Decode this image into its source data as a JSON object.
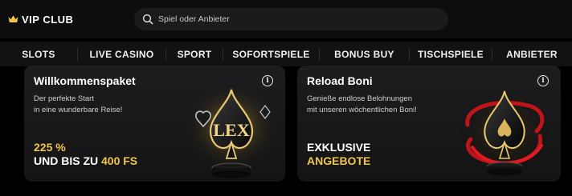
{
  "header": {
    "logo_text": "VIP CLUB",
    "logo_icon": "crown-icon",
    "search_placeholder": "Spiel oder Anbieter",
    "search_icon": "search-icon"
  },
  "nav": {
    "items": [
      {
        "label": "SLOTS"
      },
      {
        "label": "LIVE CASINO"
      },
      {
        "label": "SPORT"
      },
      {
        "label": "SOFORTSPIELE"
      },
      {
        "label": "BONUS BUY"
      },
      {
        "label": "TISCHSPIELE"
      },
      {
        "label": "ANBIETER"
      }
    ]
  },
  "cards": [
    {
      "title": "Willkommenspaket",
      "desc_line1": "Der perfekte Start",
      "desc_line2": "in eine wunderbare Reise!",
      "promo_line1_value": "225 %",
      "promo_line2_prefix": "UND BIS ZU ",
      "promo_line2_value": "400 FS",
      "art_text": "LEX"
    },
    {
      "title": "Reload Boni",
      "desc_line1": "Genieße endlose Belohnungen",
      "desc_line2": "mit unseren wöchentlichen Boni!",
      "promo_line1": "EXKLUSIVE",
      "promo_line2": "ANGEBOTE"
    }
  ],
  "colors": {
    "accent_gold": "#f2c64a",
    "background": "#000000",
    "card_bg": "#1a1a1c",
    "ribbon_red": "#d4151c"
  }
}
